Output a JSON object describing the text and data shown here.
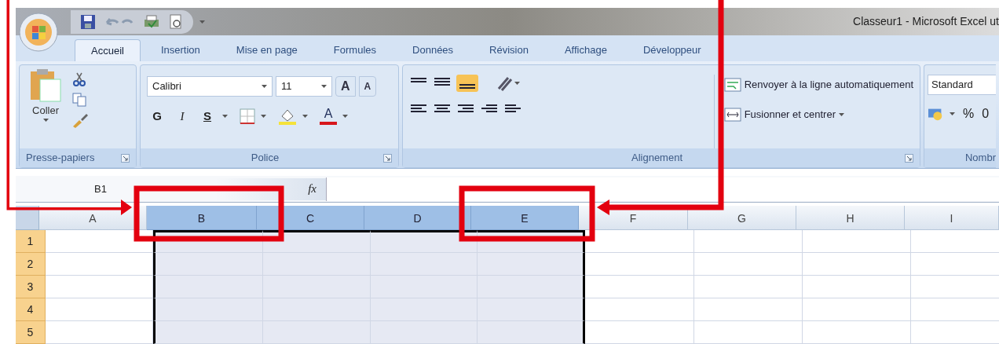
{
  "window": {
    "title": "Classeur1 - Microsoft Excel ut"
  },
  "tabs": [
    {
      "label": "Accueil",
      "selected": true
    },
    {
      "label": "Insertion",
      "selected": false
    },
    {
      "label": "Mise en page",
      "selected": false
    },
    {
      "label": "Formules",
      "selected": false
    },
    {
      "label": "Données",
      "selected": false
    },
    {
      "label": "Révision",
      "selected": false
    },
    {
      "label": "Affichage",
      "selected": false
    },
    {
      "label": "Développeur",
      "selected": false
    }
  ],
  "ribbon": {
    "clipboard": {
      "paste_label": "Coller",
      "group_label": "Presse-papiers"
    },
    "font": {
      "font_name": "Calibri",
      "font_size": "11",
      "grow": "A",
      "shrink": "A",
      "bold": "G",
      "italic": "I",
      "underline": "S",
      "font_color": "A",
      "group_label": "Police"
    },
    "alignment": {
      "wrap_text": "Renvoyer à la ligne automatiquement",
      "merge_center": "Fusionner et centrer",
      "group_label": "Alignement"
    },
    "number": {
      "format": "Standard",
      "percent": "%",
      "thousands": "0",
      "group_label": "Nombr"
    }
  },
  "formula_bar": {
    "name_box": "B1",
    "fx": "fx"
  },
  "sheet": {
    "columns": [
      {
        "label": "A",
        "selected": false
      },
      {
        "label": "B",
        "selected": true
      },
      {
        "label": "C",
        "selected": true
      },
      {
        "label": "D",
        "selected": true
      },
      {
        "label": "E",
        "selected": true
      },
      {
        "label": "F",
        "selected": false
      },
      {
        "label": "G",
        "selected": false
      },
      {
        "label": "H",
        "selected": false
      },
      {
        "label": "I",
        "selected": false
      }
    ],
    "rows": [
      {
        "label": "1",
        "selected": true
      },
      {
        "label": "2",
        "selected": true
      },
      {
        "label": "3",
        "selected": true
      },
      {
        "label": "4",
        "selected": true
      },
      {
        "label": "5",
        "selected": true
      }
    ]
  }
}
